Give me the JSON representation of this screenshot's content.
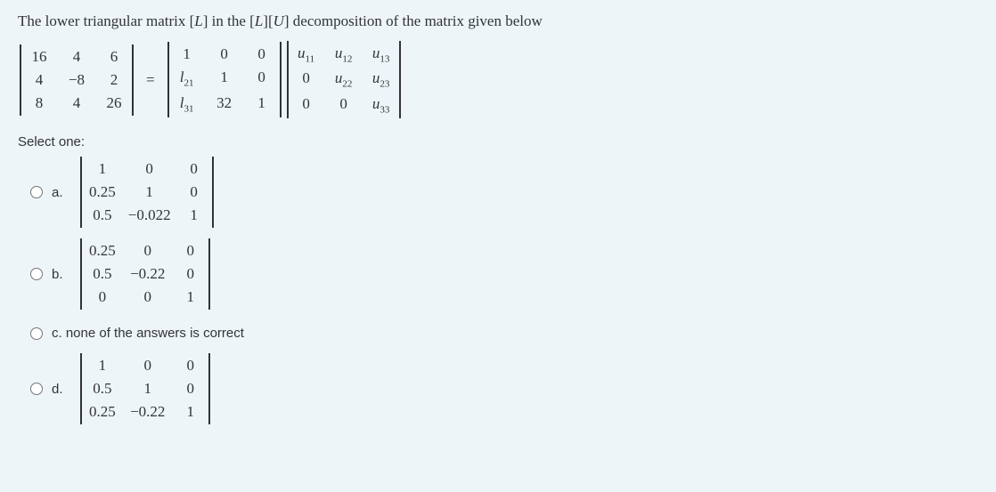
{
  "question": "The lower triangular matrix [L] in the [L][U] decomposition of the matrix given below",
  "matrixA": {
    "r1c1": "16",
    "r1c2": "4",
    "r1c3": "6",
    "r2c1": "4",
    "r2c2": "−8",
    "r2c3": "2",
    "r3c1": "8",
    "r3c2": "4",
    "r3c3": "26"
  },
  "eq": "=",
  "matrixL": {
    "r1c1": "1",
    "r1c2": "0",
    "r1c3": "0",
    "r2c1": "l",
    "r2c1sub": "21",
    "r2c2": "1",
    "r2c3": "0",
    "r3c1": "l",
    "r3c1sub": "31",
    "r3c2": "32",
    "r3c3": "1"
  },
  "matrixU": {
    "r1c1": "u",
    "r1c1sub": "11",
    "r1c2": "u",
    "r1c2sub": "12",
    "r1c3": "u",
    "r1c3sub": "13",
    "r2c1": "0",
    "r2c2": "u",
    "r2c2sub": "22",
    "r2c3": "u",
    "r2c3sub": "23",
    "r3c1": "0",
    "r3c2": "0",
    "r3c3": "u",
    "r3c3sub": "33"
  },
  "select": "Select one:",
  "options": {
    "a": {
      "label": "a.",
      "m": {
        "r1c1": "1",
        "r1c2": "0",
        "r1c3": "0",
        "r2c1": "0.25",
        "r2c2": "1",
        "r2c3": "0",
        "r3c1": "0.5",
        "r3c2": "−0.022",
        "r3c3": "1"
      }
    },
    "b": {
      "label": "b.",
      "m": {
        "r1c1": "0.25",
        "r1c2": "0",
        "r1c3": "0",
        "r2c1": "0.5",
        "r2c2": "−0.22",
        "r2c3": "0",
        "r3c1": "0",
        "r3c2": "0",
        "r3c3": "1"
      }
    },
    "c": {
      "label": "c. none of the answers is correct"
    },
    "d": {
      "label": "d.",
      "m": {
        "r1c1": "1",
        "r1c2": "0",
        "r1c3": "0",
        "r2c1": "0.5",
        "r2c2": "1",
        "r2c3": "0",
        "r3c1": "0.25",
        "r3c2": "−0.22",
        "r3c3": "1"
      }
    }
  }
}
